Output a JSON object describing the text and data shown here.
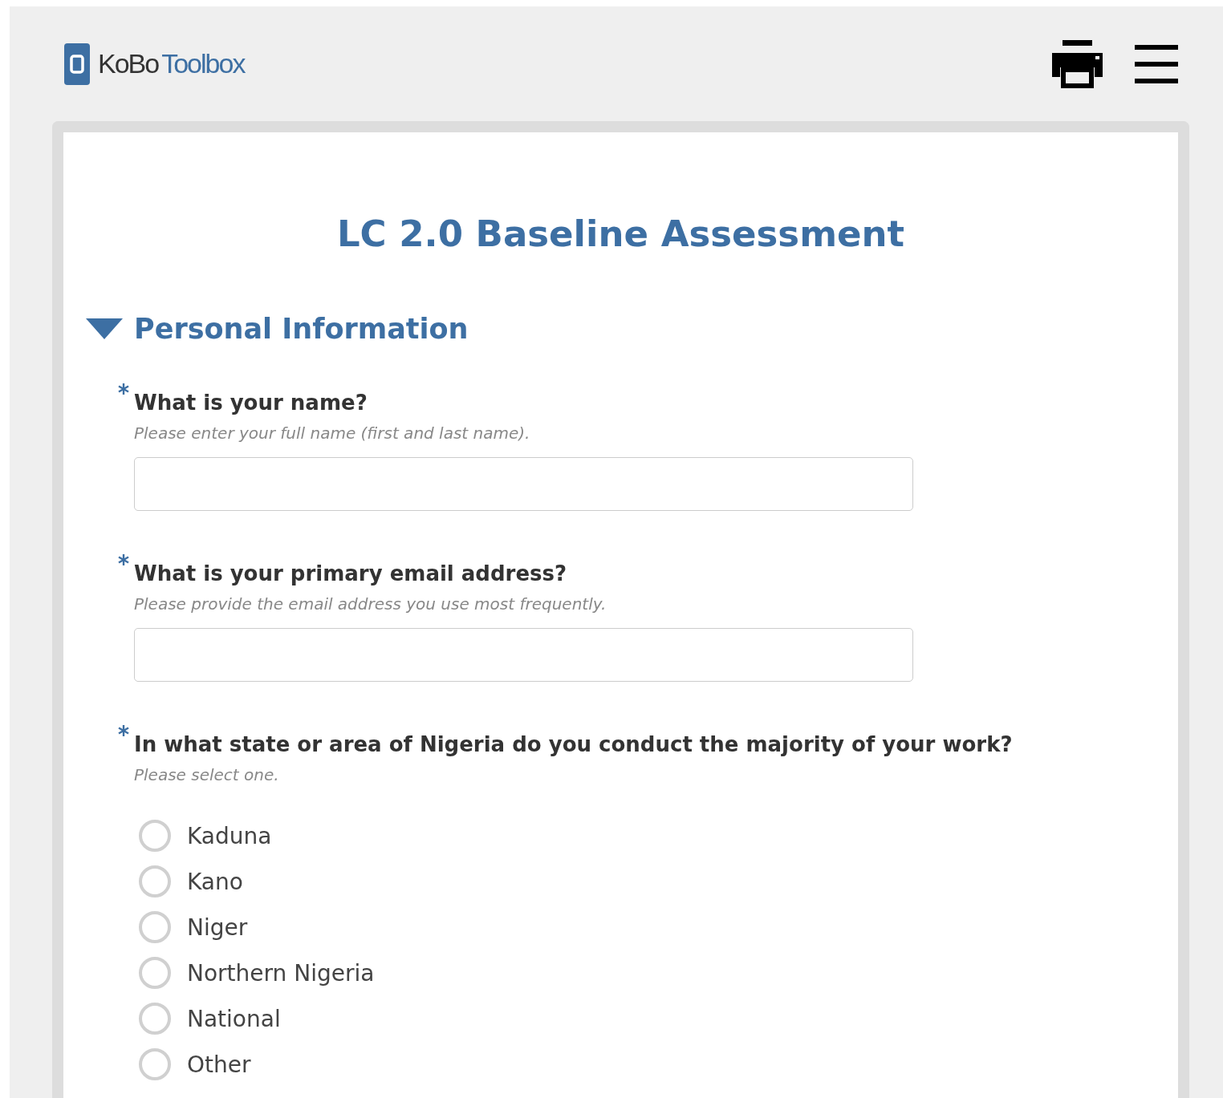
{
  "header": {
    "logo_part_1": "KoBo",
    "logo_part_2": "Toolbox"
  },
  "form": {
    "title": "LC 2.0 Baseline Assessment",
    "group": {
      "title": "Personal Information",
      "expanded": true,
      "questions": [
        {
          "kind": "text",
          "required": true,
          "label": "What is your name?",
          "hint": "Please enter your full name (first and last name)."
        },
        {
          "kind": "text",
          "required": true,
          "label": "What is your primary email address?",
          "hint": "Please provide the email address you use most frequently."
        },
        {
          "kind": "radio",
          "required": true,
          "label": "In what state or area of Nigeria do you conduct the majority of your work?",
          "hint": "Please select one.",
          "options": [
            {
              "label": "Kaduna",
              "selected": false
            },
            {
              "label": "Kano",
              "selected": false
            },
            {
              "label": "Niger",
              "selected": false
            },
            {
              "label": "Northern Nigeria",
              "selected": false
            },
            {
              "label": "National",
              "selected": false
            },
            {
              "label": "Other",
              "selected": false
            }
          ]
        }
      ]
    }
  }
}
